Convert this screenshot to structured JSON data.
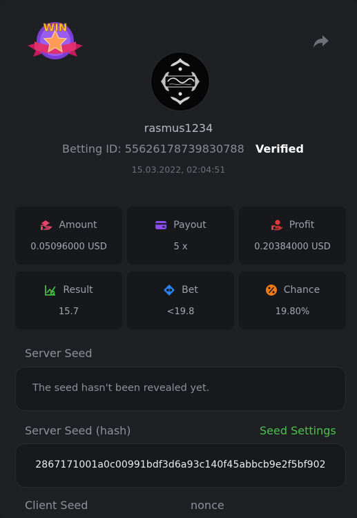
{
  "header": {
    "username": "rasmus1234",
    "betting_id": "Betting ID: 55626178739830788",
    "verified": "Verified",
    "datetime": "15.03.2022, 02:04:51"
  },
  "icons": {
    "win_badge": "win-badge",
    "badge_text": "WIN",
    "share": "share-arrow-icon",
    "avatar": "rasmus-logo-avatar"
  },
  "stats": [
    {
      "label": "Amount",
      "value": "0.05096000 USD",
      "icon": "amount-icon",
      "color": "#e8436a"
    },
    {
      "label": "Payout",
      "value": "5 x",
      "icon": "payout-wallet-icon",
      "color": "#8a4cf0"
    },
    {
      "label": "Profit",
      "value": "0.20384000 USD",
      "icon": "profit-hand-icon",
      "color": "#e03a3a"
    },
    {
      "label": "Result",
      "value": "15.7",
      "icon": "result-chart-icon",
      "color": "#3fbf3f"
    },
    {
      "label": "Bet",
      "value": "<19.8",
      "icon": "bet-tag-icon",
      "color": "#2b82f0"
    },
    {
      "label": "Chance",
      "value": "19.80%",
      "icon": "chance-percent-icon",
      "color": "#f07a1a"
    }
  ],
  "server_seed": {
    "label": "Server Seed",
    "value": "The seed hasn't been revealed yet."
  },
  "server_seed_hash": {
    "label": "Server Seed (hash)",
    "settings_link": "Seed Settings",
    "value": "2867171001a0c00991bdf3d6a93c140f45abbcb9e2f5bf902"
  },
  "client_seed": {
    "label": "Client Seed",
    "nonce_label": "nonce"
  }
}
